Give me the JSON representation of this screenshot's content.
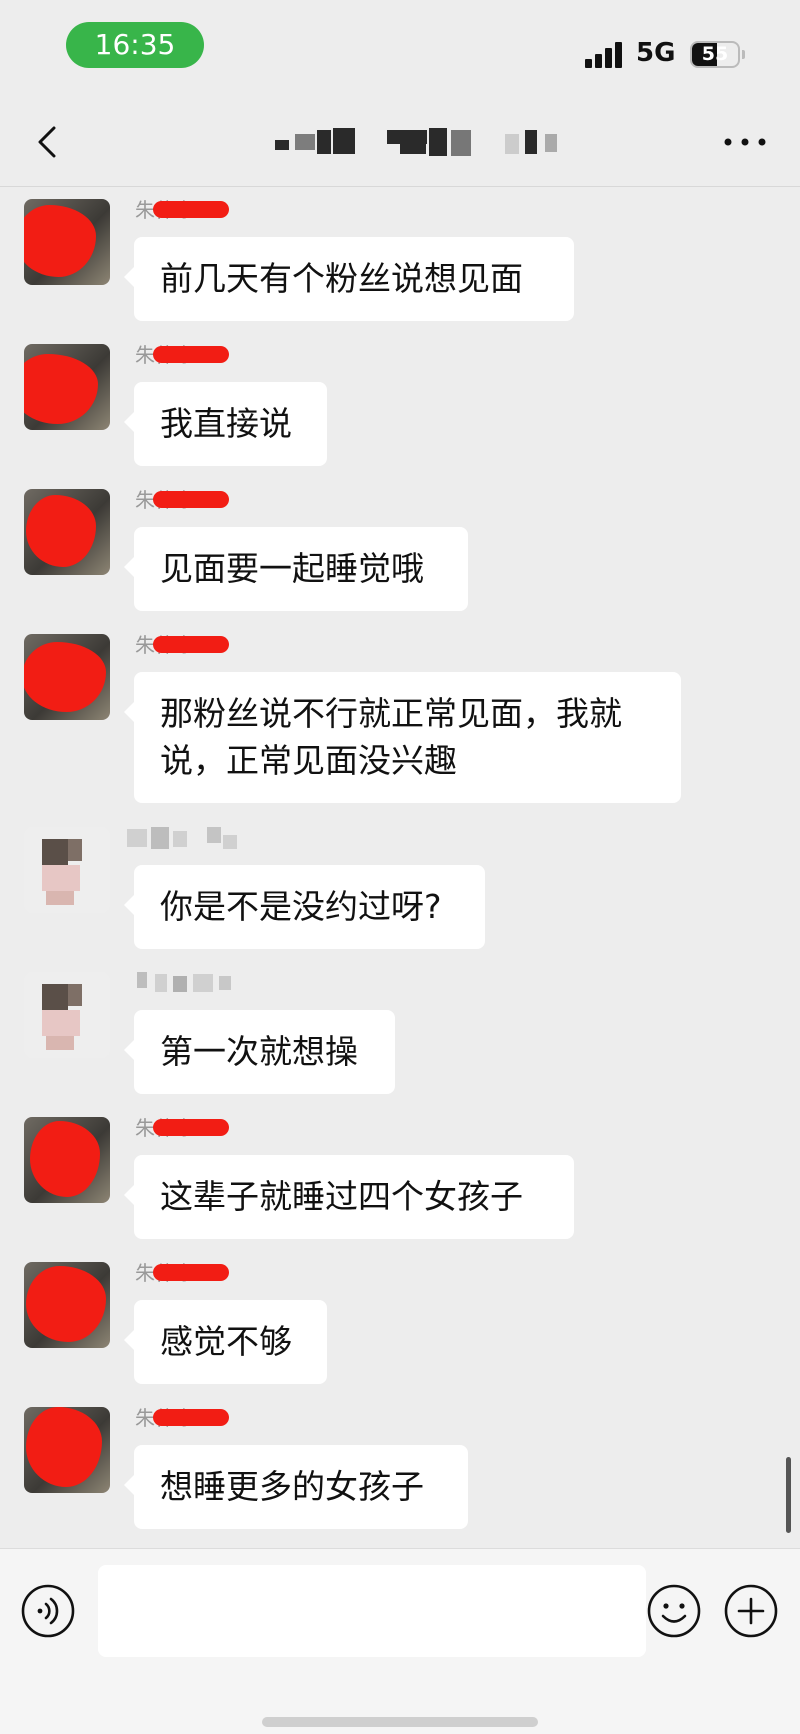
{
  "status_bar": {
    "time": "16:35",
    "network": "5G",
    "battery_level": "55",
    "signal_icon": "cellular-signal-icon"
  },
  "nav": {
    "back_icon": "chevron-left-icon",
    "more_icon": "more-dots-icon"
  },
  "messages": [
    {
      "sender": "朱伟东",
      "sender_redacted": true,
      "avatar": "redacted",
      "text": "前几天有个粉丝说想见面"
    },
    {
      "sender": "朱伟东",
      "sender_redacted": true,
      "avatar": "redacted",
      "text": "我直接说"
    },
    {
      "sender": "朱伟东",
      "sender_redacted": true,
      "avatar": "redacted",
      "text": "见面要一起睡觉哦"
    },
    {
      "sender": "朱伟东",
      "sender_redacted": true,
      "avatar": "redacted",
      "text": "那粉丝说不行就正常见面，我就说，正常见面没兴趣"
    },
    {
      "sender": "",
      "sender_redacted": false,
      "avatar": "blurred",
      "text": "你是不是没约过呀?"
    },
    {
      "sender": "",
      "sender_redacted": false,
      "avatar": "blurred",
      "text": "第一次就想操"
    },
    {
      "sender": "朱伟东",
      "sender_redacted": true,
      "avatar": "redacted",
      "text": "这辈子就睡过四个女孩子"
    },
    {
      "sender": "朱伟东",
      "sender_redacted": true,
      "avatar": "redacted",
      "text": "感觉不够"
    },
    {
      "sender": "朱伟东",
      "sender_redacted": true,
      "avatar": "redacted",
      "text": "想睡更多的女孩子"
    }
  ],
  "input_bar": {
    "placeholder": "",
    "voice_icon": "voice-input-icon",
    "emoji_icon": "emoji-icon",
    "add_icon": "plus-circle-icon"
  },
  "colors": {
    "background": "#ededed",
    "bubble": "#ffffff",
    "time_pill": "#38b54a",
    "redaction": "#f21d14"
  }
}
